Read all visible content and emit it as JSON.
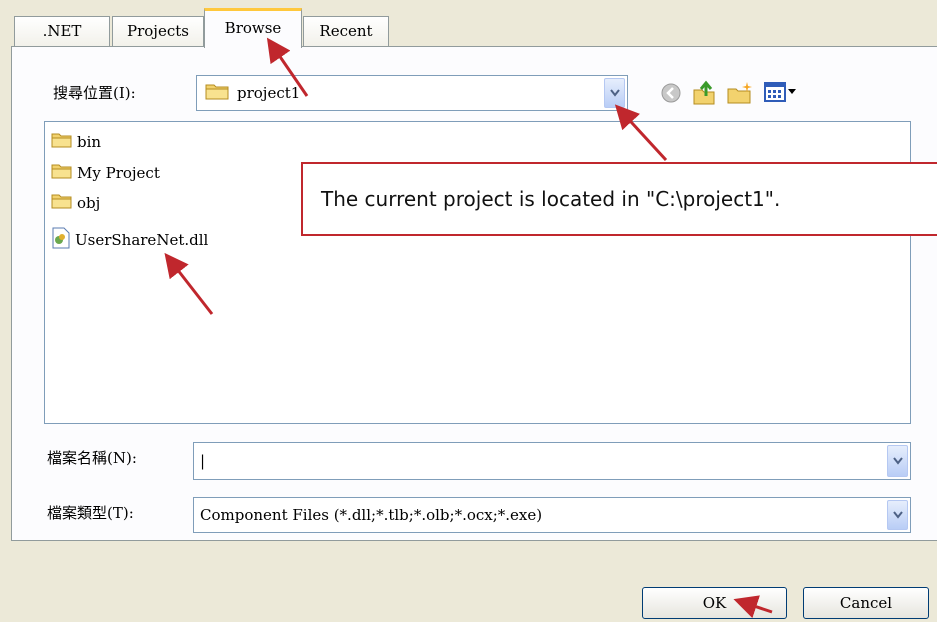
{
  "tabs": [
    ".NET",
    "Projects",
    "Browse",
    "Recent"
  ],
  "active_tab": "Browse",
  "look_in": {
    "label": "搜尋位置(I):",
    "value": "project1"
  },
  "files": [
    {
      "name": "bin",
      "type": "folder"
    },
    {
      "name": "My Project",
      "type": "folder"
    },
    {
      "name": "obj",
      "type": "folder"
    },
    {
      "name": "UserShareNet.dll",
      "type": "dll"
    }
  ],
  "file_name": {
    "label": "檔案名稱(N):",
    "value": "|"
  },
  "file_type": {
    "label": "檔案類型(T):",
    "value": "Component Files (*.dll;*.tlb;*.olb;*.ocx;*.exe)"
  },
  "buttons": {
    "ok": "OK",
    "cancel": "Cancel"
  },
  "annotation": "The current project is located in  \"C:\\project1\".",
  "colors": {
    "dialog_bg": "#ECE9D8",
    "annotation_red": "#C0272D",
    "active_tab_accent": "#FFC83C"
  }
}
